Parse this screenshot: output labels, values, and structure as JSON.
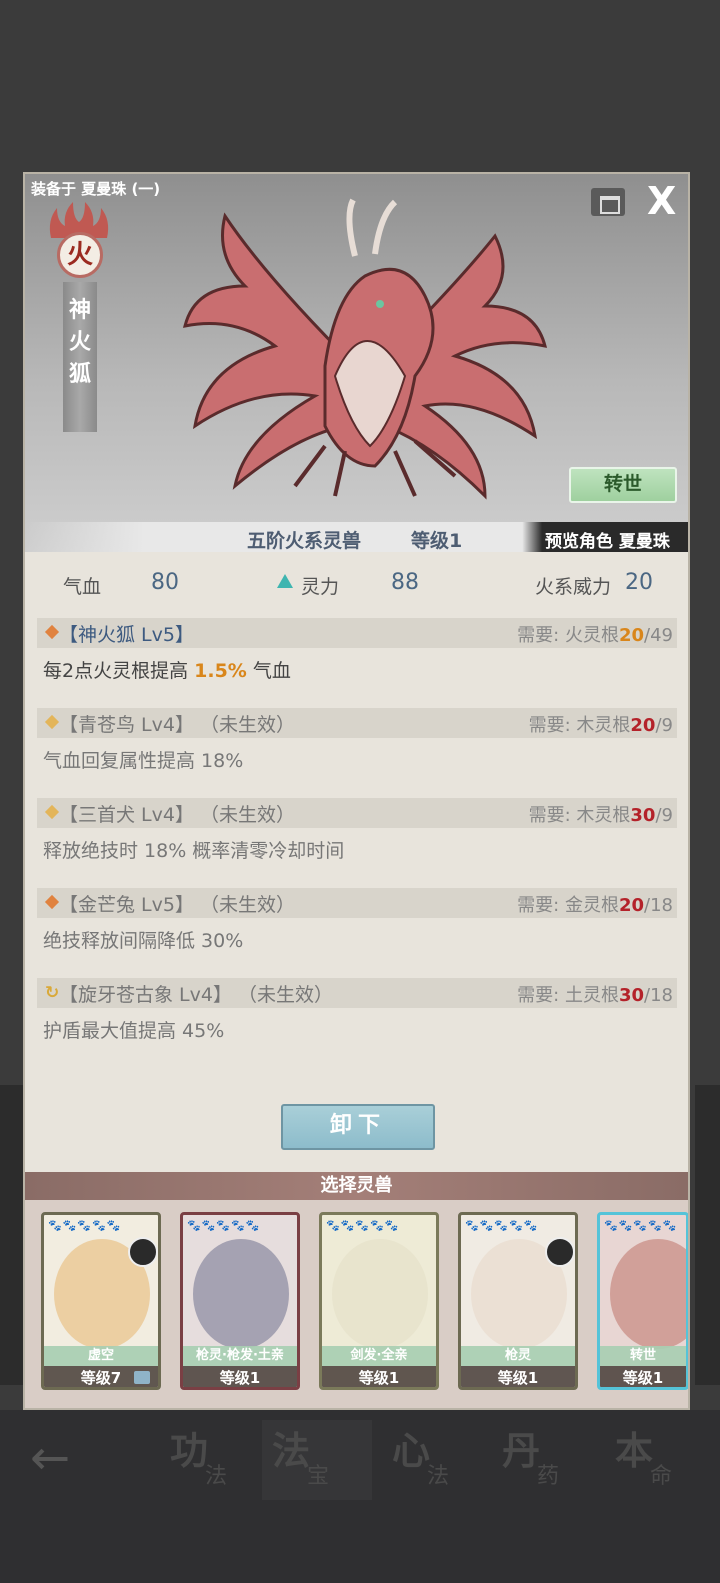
{
  "background": {
    "tabs": [
      {
        "big": "功",
        "small": "法"
      },
      {
        "big": "法",
        "small": "宝"
      },
      {
        "big": "心",
        "small": "法"
      },
      {
        "big": "丹",
        "small": "药"
      },
      {
        "big": "本",
        "small": "命"
      }
    ]
  },
  "header": {
    "equipped_on": "装备于 夏曼珠 (一)",
    "element": "火",
    "beast_name_vertical": "神火狐",
    "reincarnate_label": "转世",
    "tier": "五阶火系灵兽",
    "level": "等级1",
    "preview": "预览角色 夏曼珠"
  },
  "stats": [
    {
      "label": "气血",
      "value": "80"
    },
    {
      "label": "灵力",
      "value": "88"
    },
    {
      "label": "火系威力",
      "value": "20"
    }
  ],
  "bonuses": [
    {
      "title": "【神火狐 Lv5】",
      "req_label": "需要:",
      "req_root": "火灵根",
      "req_cur": "20",
      "req_max": "/49",
      "desc_pre": "每2点火灵根提高 ",
      "desc_hl": "1.5%",
      "desc_post": " 气血",
      "active": true,
      "marker_color": "#e0823f"
    },
    {
      "title": "【青苍鸟 Lv4】 （未生效）",
      "req_label": "需要:",
      "req_root": "木灵根",
      "req_cur": "20",
      "req_max": "/9",
      "desc": "气血回复属性提高 18%",
      "active": false,
      "marker_color": "#e3b55a"
    },
    {
      "title": "【三首犬 Lv4】 （未生效）",
      "req_label": "需要:",
      "req_root": "木灵根",
      "req_cur": "30",
      "req_max": "/9",
      "desc": "释放绝技时 18% 概率清零冷却时间",
      "active": false,
      "marker_color": "#e3b55a"
    },
    {
      "title": "【金芒兔 Lv5】 （未生效）",
      "req_label": "需要:",
      "req_root": "金灵根",
      "req_cur": "20",
      "req_max": "/18",
      "desc": "绝技释放间隔降低 30%",
      "active": false,
      "marker_color": "#e0823f"
    },
    {
      "title": "【旋牙苍古象 Lv4】 （未生效）",
      "req_label": "需要:",
      "req_root": "土灵根",
      "req_cur": "30",
      "req_max": "/18",
      "desc": "护盾最大值提高 45%",
      "active": false,
      "marker_color": "#d9a93a"
    }
  ],
  "unequip_label": "卸下",
  "select_title": "选择灵兽",
  "cards": [
    {
      "tag": "虚空",
      "level": "等级7",
      "paws": "🐾🐾🐾🐾🐾",
      "art_color": "#e9c48e",
      "frame": "#6d6a52",
      "avatar": true,
      "lock": true
    },
    {
      "tag": "枪灵·枪发·土亲",
      "level": "等级1",
      "paws": "🐾🐾🐾🐾🐾",
      "art_color": "#8f8ea3",
      "frame": "#7a3f44",
      "avatar": false,
      "lock": false
    },
    {
      "tag": "剑发·全亲",
      "level": "等级1",
      "paws": "🐾🐾🐾🐾🐾",
      "art_color": "#e5e2c9",
      "frame": "#7b7a5a",
      "avatar": false,
      "lock": false
    },
    {
      "tag": "枪灵",
      "level": "等级1",
      "paws": "🐾🐾🐾🐾🐾",
      "art_color": "#e9dccf",
      "frame": "#6d6a52",
      "avatar": true,
      "lock": false
    },
    {
      "tag": "转世",
      "level": "等级1",
      "paws": "🐾🐾🐾🐾🐾",
      "art_color": "#c98d86",
      "frame": "#55c3d8",
      "avatar": false,
      "lock": false
    }
  ],
  "colors": {
    "accent_orange": "#d9861b",
    "accent_red": "#b4222a",
    "title_blue": "#3d5a80"
  }
}
